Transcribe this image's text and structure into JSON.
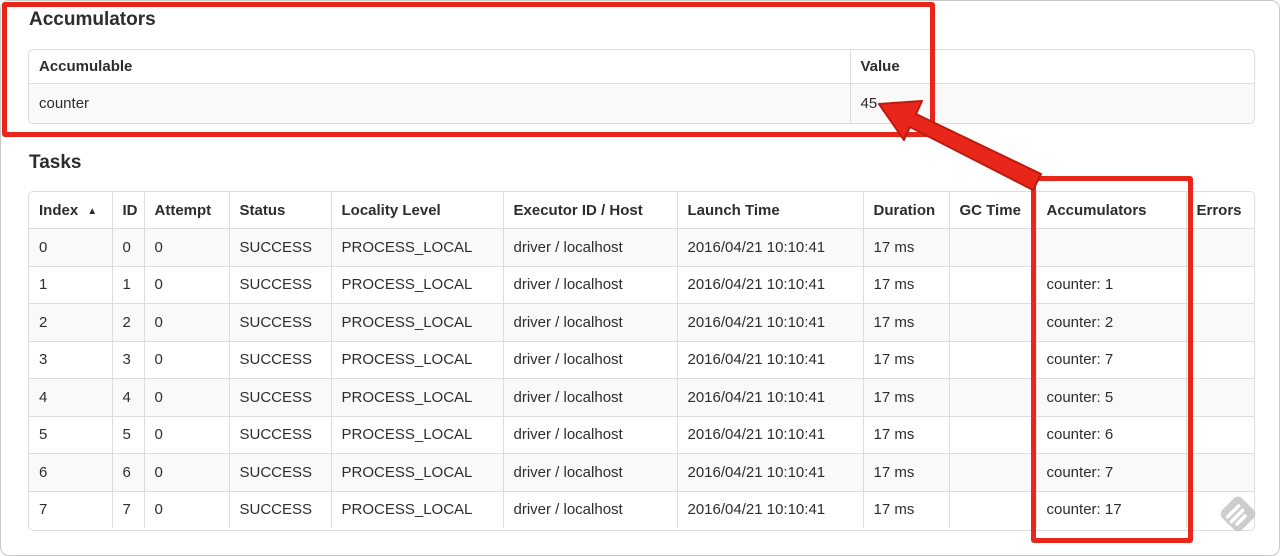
{
  "annotation": {
    "color": "#e8261a",
    "outline": "#bf1a0e"
  },
  "watermark": {
    "color": "#c8c8c8"
  },
  "accumulators_section": {
    "title": "Accumulators",
    "table": {
      "headers": [
        "Accumulable",
        "Value"
      ],
      "rows": [
        [
          "counter",
          "45"
        ]
      ]
    }
  },
  "tasks_section": {
    "title": "Tasks",
    "table": {
      "sort_indicator": "▲",
      "headers": [
        "Index",
        "ID",
        "Attempt",
        "Status",
        "Locality Level",
        "Executor ID / Host",
        "Launch Time",
        "Duration",
        "GC Time",
        "Accumulators",
        "Errors"
      ],
      "rows": [
        [
          "0",
          "0",
          "0",
          "SUCCESS",
          "PROCESS_LOCAL",
          "driver / localhost",
          "2016/04/21 10:10:41",
          "17 ms",
          "",
          "",
          ""
        ],
        [
          "1",
          "1",
          "0",
          "SUCCESS",
          "PROCESS_LOCAL",
          "driver / localhost",
          "2016/04/21 10:10:41",
          "17 ms",
          "",
          "counter: 1",
          ""
        ],
        [
          "2",
          "2",
          "0",
          "SUCCESS",
          "PROCESS_LOCAL",
          "driver / localhost",
          "2016/04/21 10:10:41",
          "17 ms",
          "",
          "counter: 2",
          ""
        ],
        [
          "3",
          "3",
          "0",
          "SUCCESS",
          "PROCESS_LOCAL",
          "driver / localhost",
          "2016/04/21 10:10:41",
          "17 ms",
          "",
          "counter: 7",
          ""
        ],
        [
          "4",
          "4",
          "0",
          "SUCCESS",
          "PROCESS_LOCAL",
          "driver / localhost",
          "2016/04/21 10:10:41",
          "17 ms",
          "",
          "counter: 5",
          ""
        ],
        [
          "5",
          "5",
          "0",
          "SUCCESS",
          "PROCESS_LOCAL",
          "driver / localhost",
          "2016/04/21 10:10:41",
          "17 ms",
          "",
          "counter: 6",
          ""
        ],
        [
          "6",
          "6",
          "0",
          "SUCCESS",
          "PROCESS_LOCAL",
          "driver / localhost",
          "2016/04/21 10:10:41",
          "17 ms",
          "",
          "counter: 7",
          ""
        ],
        [
          "7",
          "7",
          "0",
          "SUCCESS",
          "PROCESS_LOCAL",
          "driver / localhost",
          "2016/04/21 10:10:41",
          "17 ms",
          "",
          "counter: 17",
          ""
        ]
      ]
    }
  }
}
